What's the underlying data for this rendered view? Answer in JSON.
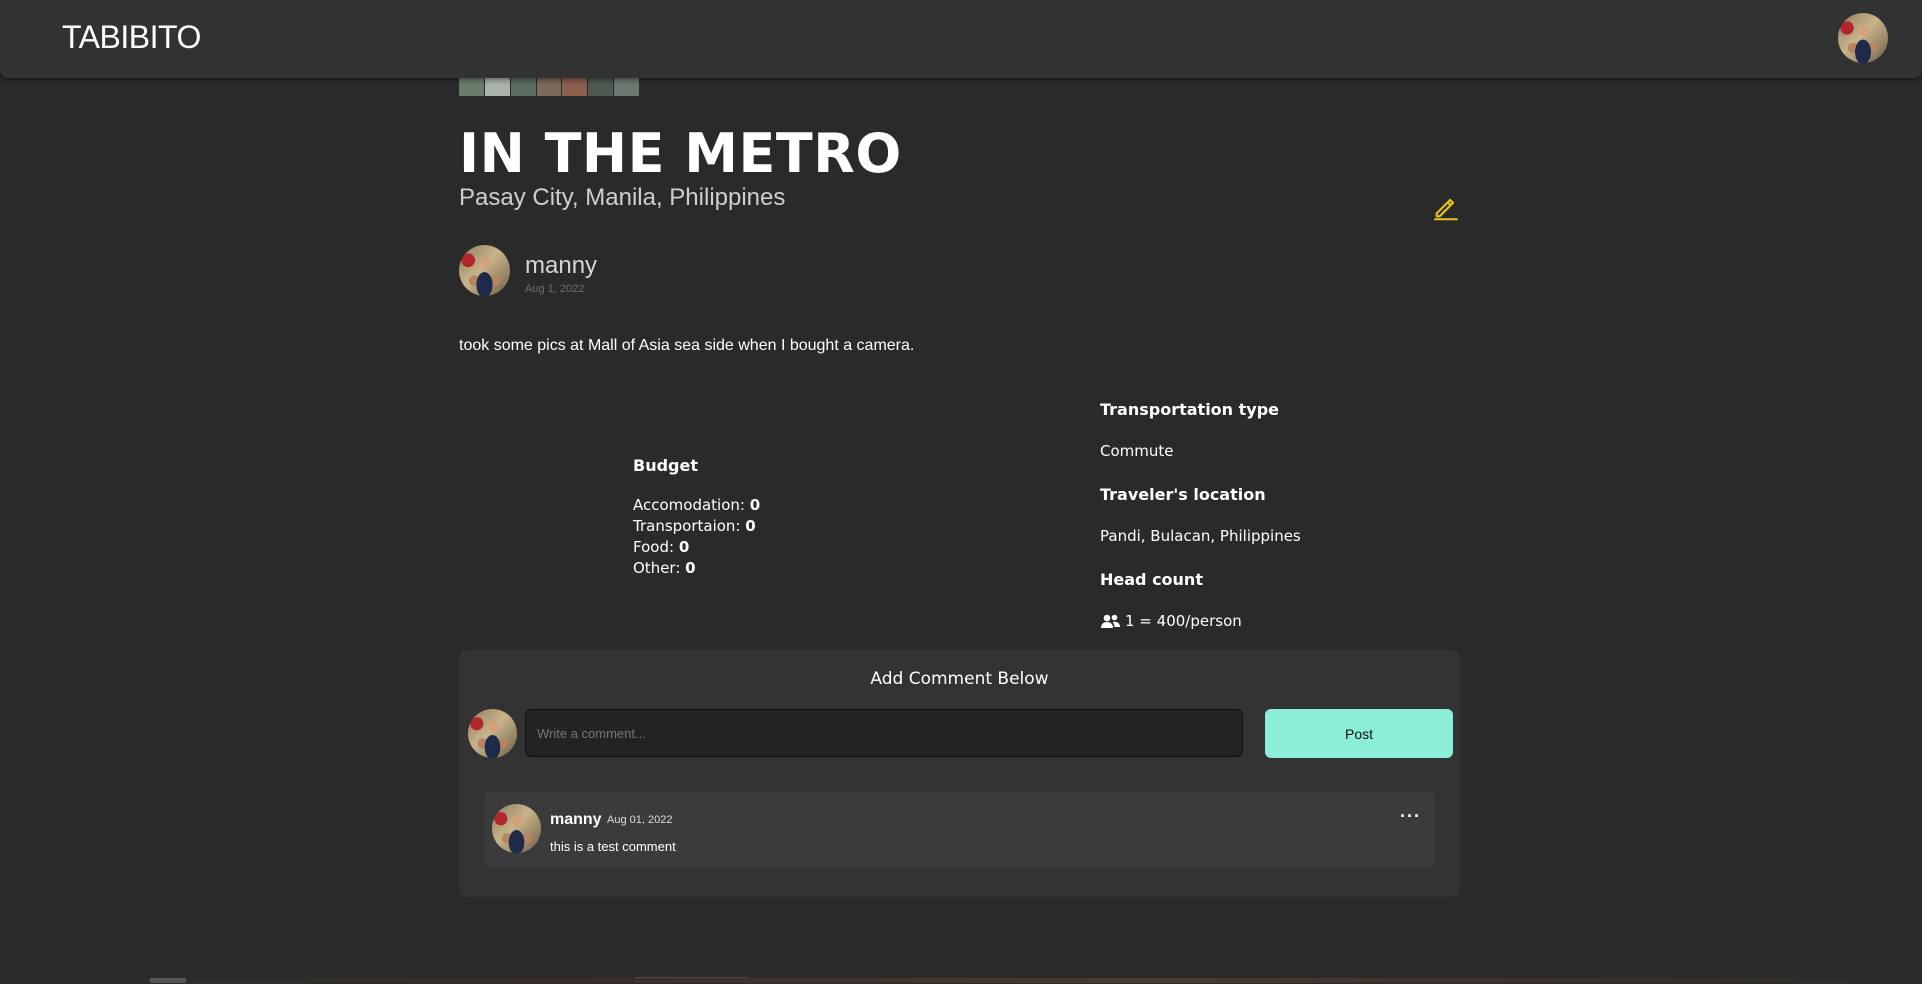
{
  "navbar": {
    "brand": "TABIBITO",
    "avatar_icon": "user-avatar"
  },
  "gallery": {
    "thumbnail_colors": [
      "#6b7d6a",
      "#aab4a8",
      "#5b6b62",
      "#7a6a5a",
      "#8c5e4e",
      "#4c5a52",
      "#6a7a70"
    ]
  },
  "post": {
    "title": "IN THE METRO",
    "location": "Pasay City, Manila, Philippines",
    "edit_icon": "pencil-icon",
    "author": {
      "name": "manny",
      "date": "Aug 1, 2022"
    },
    "description": "took some pics at Mall of Asia sea side when I bought a camera."
  },
  "budget": {
    "heading": "Budget",
    "items": [
      {
        "label": "Accomodation:",
        "value": "0"
      },
      {
        "label": "Transportaion:",
        "value": "0"
      },
      {
        "label": "Food:",
        "value": "0"
      },
      {
        "label": "Other:",
        "value": "0"
      }
    ]
  },
  "details": {
    "transportation_label": "Transportation type",
    "transportation_value": "Commute",
    "traveler_location_label": "Traveler's location",
    "traveler_location_value": "Pandi, Bulacan, Philippines",
    "head_count_label": "Head count",
    "head_count_icon": "users-icon",
    "head_count_value": "1 = 400/person"
  },
  "comments": {
    "heading": "Add Comment Below",
    "placeholder": "Write a comment...",
    "post_label": "Post",
    "items": [
      {
        "name": "manny",
        "date": "Aug 01, 2022",
        "text": "this is a test comment",
        "menu": "···"
      }
    ]
  },
  "accent_colors": {
    "post_button": "#8ceed8",
    "edit_icon": "#e9c21a",
    "background": "#2a2a2a"
  }
}
